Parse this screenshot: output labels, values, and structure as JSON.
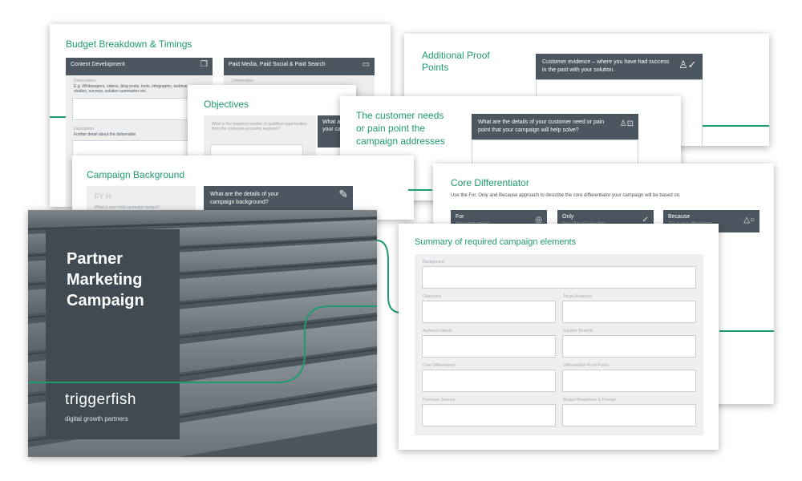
{
  "colors": {
    "accent": "#1f9b6e",
    "dark": "#4b5660",
    "panel": "#3f4a53"
  },
  "budget": {
    "title": "Budget Breakdown & Timings",
    "col1": "Content Development",
    "col2": "Paid Media, Paid Social & Paid Search",
    "deliverables_label": "Deliverables",
    "deliverables_hint": "E.g. Whitepapers, videos, blog posts, tools, infographic, webinars, case studies, surveys, solution summaries etc.",
    "description_label": "Description",
    "description_hint": "Further detail about the deliverable",
    "col2_sub": "Deliverables"
  },
  "objectives": {
    "title": "Objectives",
    "question": "What is the targeted number of qualified opportunities from the corporate accounts segment?",
    "bar_text": "What are the objectives of your campaign?"
  },
  "background": {
    "title": "Campaign Background",
    "fy": "FY H",
    "sub": "What is your total campaign budget?",
    "bar_text": "What are the details of your campaign background?"
  },
  "proof": {
    "title": "Additional Proof Points",
    "bar_text": "Customer evidence – where you have had success in the past with your solution."
  },
  "needs": {
    "title": "The customer needs or pain point the campaign addresses",
    "bar_text": "What are the details of your customer need or pain point that your campaign will help solve?"
  },
  "differentiator": {
    "title": "Core Differentiator",
    "intro": "Use the For, Only and Because approach to describe the core differentiator your campaign will be based on.",
    "cols": [
      "For",
      "Only",
      "Because"
    ],
    "col_hints": [
      "Your target market",
      "Your offer will solve their",
      "This is your differentiator"
    ]
  },
  "cover": {
    "title_line1": "Partner",
    "title_line2": "Marketing",
    "title_line3": "Campaign",
    "brand": "triggerfish",
    "tagline": "digital growth partners"
  },
  "summary": {
    "title": "Summary of required campaign elements",
    "fields": {
      "background": "Background",
      "objectives": "Objectives",
      "target_audience": "Target Audience",
      "audience_needs": "Audience Needs",
      "solution_benefits": "Solution Benefits",
      "core_differentiator": "Core Differentiator",
      "differentiator_proof": "Differentiator Proof Points",
      "purchase_journey": "Purchase Journey",
      "budget_timings": "Budget Breakdown & Timings"
    }
  }
}
